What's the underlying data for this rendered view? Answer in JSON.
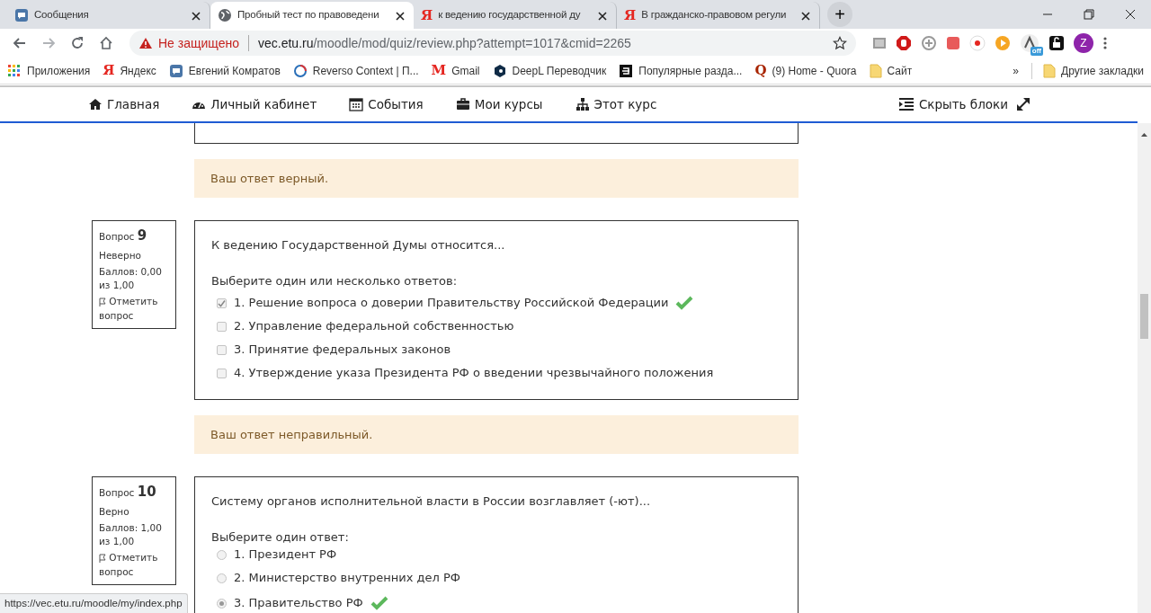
{
  "browser": {
    "tabs": [
      {
        "title": "Сообщения",
        "kind": "chat",
        "selected": false
      },
      {
        "title": "Пробный тест по правоведени",
        "kind": "globe",
        "selected": true
      },
      {
        "title": "к ведению государственной ду",
        "kind": "yandex",
        "glyph": "Я",
        "selected": false
      },
      {
        "title": "В гражданско-правовом регули",
        "kind": "yandex",
        "glyph": "Я",
        "selected": false
      }
    ],
    "new_tab": "+",
    "address": {
      "warning": "Не защищено",
      "host": "vec.etu.ru",
      "path": "/moodle/mod/quiz/review.php?attempt=1017&cmid=2265"
    },
    "extensions": {
      "badge": "off",
      "avatar": "Z"
    },
    "bookmarks": [
      {
        "title": "Приложения",
        "kind": "apps"
      },
      {
        "title": "Яндекс",
        "kind": "yandex",
        "glyph": "Я"
      },
      {
        "title": "Евгений Комратов",
        "kind": "chat"
      },
      {
        "title": "Reverso Context | П...",
        "kind": "reverso"
      },
      {
        "title": "Gmail",
        "kind": "gmail",
        "glyph": "M"
      },
      {
        "title": "DeepL Переводчик",
        "kind": "deepl"
      },
      {
        "title": "Популярные разда...",
        "kind": "dark"
      },
      {
        "title": "(9) Home - Quora",
        "kind": "quora",
        "glyph": "Q"
      },
      {
        "title": "Сайт",
        "kind": "folder"
      }
    ],
    "more": "»",
    "other_bookmarks": "Другие закладки",
    "status_url": "https://vec.etu.ru/moodle/my/index.php"
  },
  "nav": {
    "items": [
      {
        "label": "Главная",
        "kind": "home"
      },
      {
        "label": "Личный кабинет",
        "kind": "dashboard"
      },
      {
        "label": "События",
        "kind": "calendar"
      },
      {
        "label": "Мои курсы",
        "kind": "briefcase"
      },
      {
        "label": "Этот курс",
        "kind": "sitemap"
      }
    ],
    "hide_blocks": "Скрыть блоки"
  },
  "previous_feedback": "Ваш ответ верный.",
  "questions": [
    {
      "label": "Вопрос",
      "number": "9",
      "state": "Неверно",
      "grade": "Баллов: 0,00 из 1,00",
      "flag": "Отметить вопрос",
      "text": "К ведению Государственной Думы относится...",
      "prompt": "Выберите один или несколько ответов:",
      "kind": "checkbox",
      "answers": [
        {
          "label": "1. Решение вопроса о доверии Правительству Российской Федерации",
          "selected": true,
          "correct": true
        },
        {
          "label": "2. Управление федеральной собственностью",
          "selected": false,
          "correct": false
        },
        {
          "label": "3. Принятие федеральных законов",
          "selected": false,
          "correct": false
        },
        {
          "label": "4. Утверждение указа Президента РФ о введении чрезвычайного положения",
          "selected": false,
          "correct": false
        }
      ],
      "feedback": "Ваш ответ неправильный."
    },
    {
      "label": "Вопрос",
      "number": "10",
      "state": "Верно",
      "grade": "Баллов: 1,00 из 1,00",
      "flag": "Отметить вопрос",
      "text": "Систему органов исполнительной власти в России возглавляет (-ют)...",
      "prompt": "Выберите один ответ:",
      "kind": "radio",
      "answers": [
        {
          "label": "1. Президент РФ",
          "selected": false,
          "correct": false
        },
        {
          "label": "2. Министерство внутренних дел РФ",
          "selected": false,
          "correct": false
        },
        {
          "label": "3. Правительство РФ",
          "selected": true,
          "correct": true
        }
      ]
    }
  ]
}
